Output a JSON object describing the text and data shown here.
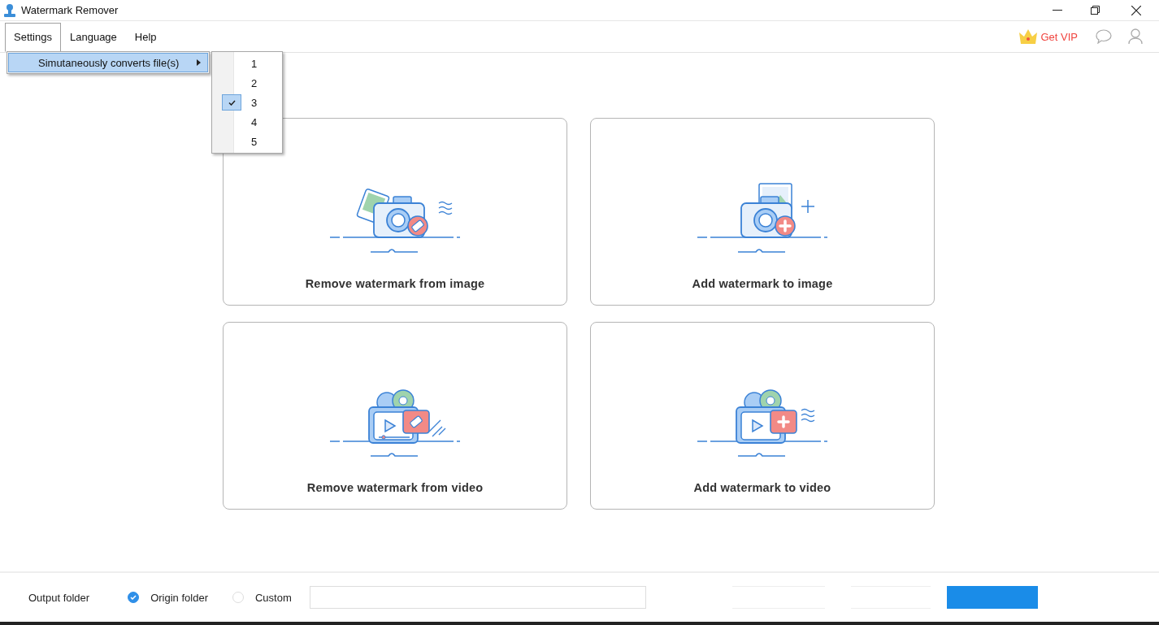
{
  "window": {
    "title": "Watermark Remover"
  },
  "menu": [
    {
      "label": "Settings",
      "selected": true
    },
    {
      "label": "Language",
      "selected": false
    },
    {
      "label": "Help",
      "selected": false
    }
  ],
  "dropdown": {
    "items": [
      {
        "label": "Simutaneously converts file(s)",
        "selected": true
      }
    ]
  },
  "submenu": {
    "items": [
      {
        "label": "1",
        "checked": false
      },
      {
        "label": "2",
        "checked": false
      },
      {
        "label": "3",
        "checked": true
      },
      {
        "label": "4",
        "checked": false
      },
      {
        "label": "5",
        "checked": false
      }
    ]
  },
  "vip": {
    "label": "Get VIP"
  },
  "cards": [
    {
      "kind": "remove-image",
      "label": "Remove watermark from image"
    },
    {
      "kind": "add-image",
      "label": "Add watermark to image"
    },
    {
      "kind": "remove-video",
      "label": "Remove watermark from video"
    },
    {
      "kind": "add-video",
      "label": "Add watermark to video"
    }
  ],
  "output": {
    "label": "Output folder",
    "options": [
      {
        "label": "Origin folder",
        "selected": true
      },
      {
        "label": "Custom",
        "selected": false
      }
    ]
  }
}
